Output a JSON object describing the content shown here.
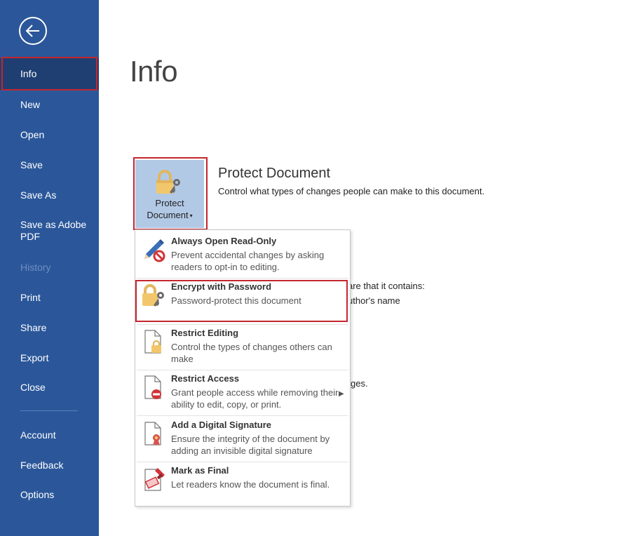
{
  "sidebar": {
    "items": [
      {
        "label": "Info"
      },
      {
        "label": "New"
      },
      {
        "label": "Open"
      },
      {
        "label": "Save"
      },
      {
        "label": "Save As"
      },
      {
        "label": "Save as Adobe PDF"
      },
      {
        "label": "History"
      },
      {
        "label": "Print"
      },
      {
        "label": "Share"
      },
      {
        "label": "Export"
      },
      {
        "label": "Close"
      },
      {
        "label": "Account"
      },
      {
        "label": "Feedback"
      },
      {
        "label": "Options"
      }
    ]
  },
  "page": {
    "title": "Info"
  },
  "protect": {
    "button_label_line1": "Protect",
    "button_label_line2": "Document",
    "title": "Protect Document",
    "description": "Control what types of changes people can make to this document."
  },
  "background": {
    "inspect_partial": "are that it contains:",
    "author_partial": "uthor's name",
    "versions_partial": "ges."
  },
  "menu": {
    "items": [
      {
        "title": "Always Open Read-Only",
        "desc": "Prevent accidental changes by asking readers to opt-in to editing."
      },
      {
        "title": "Encrypt with Password",
        "desc": "Password-protect this document"
      },
      {
        "title": "Restrict Editing",
        "desc": "Control the types of changes others can make"
      },
      {
        "title": "Restrict Access",
        "desc": "Grant people access while removing their ability to edit, copy, or print."
      },
      {
        "title": "Add a Digital Signature",
        "desc": "Ensure the integrity of the document by adding an invisible digital signature"
      },
      {
        "title": "Mark as Final",
        "desc": "Let readers know the document is final."
      }
    ]
  },
  "colors": {
    "sidebar": "#2b579a",
    "highlight": "#c4262e",
    "button_selected": "#b2c9e6"
  }
}
